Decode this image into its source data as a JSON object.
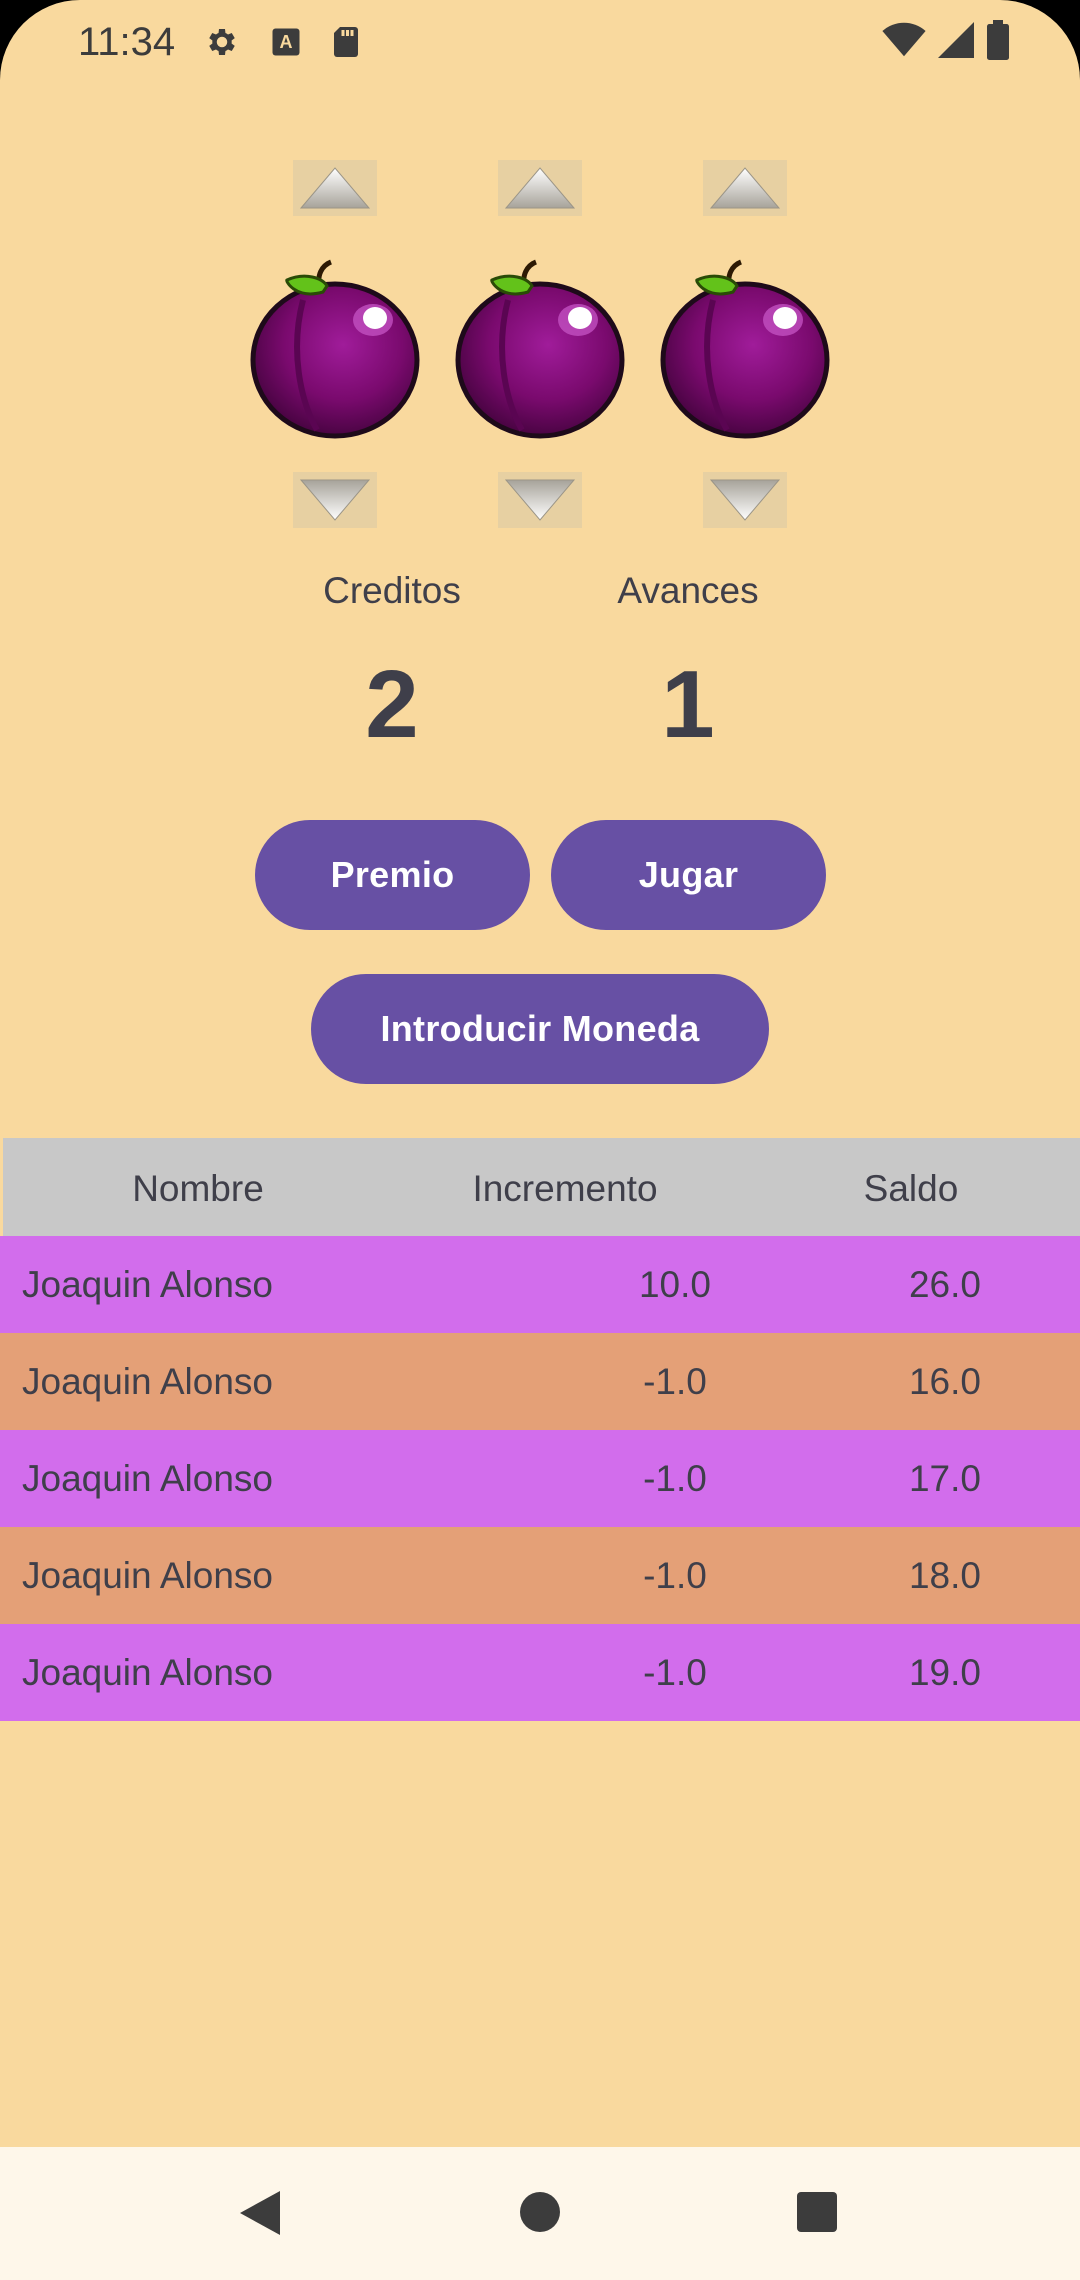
{
  "status_bar": {
    "time": "11:34",
    "icons_left": [
      "gear-icon",
      "keyboard-a-icon",
      "sd-card-icon"
    ],
    "icons_right": [
      "wifi-icon",
      "signal-icon",
      "battery-icon"
    ]
  },
  "reels": [
    {
      "symbol": "plum-icon",
      "up": "arrow-up-icon",
      "down": "arrow-down-icon"
    },
    {
      "symbol": "plum-icon",
      "up": "arrow-up-icon",
      "down": "arrow-down-icon"
    },
    {
      "symbol": "plum-icon",
      "up": "arrow-up-icon",
      "down": "arrow-down-icon"
    }
  ],
  "counters": {
    "creditos_label": "Creditos",
    "creditos_value": "2",
    "avances_label": "Avances",
    "avances_value": "1"
  },
  "buttons": {
    "premio": "Premio",
    "jugar": "Jugar",
    "introducir_moneda": "Introducir Moneda"
  },
  "table": {
    "headers": [
      "Nombre",
      "Incremento",
      "Saldo"
    ],
    "rows": [
      {
        "nombre": "Joaquin Alonso",
        "incremento": "10.0",
        "saldo": "26.0",
        "color": "#D26DEC"
      },
      {
        "nombre": "Joaquin Alonso",
        "incremento": "-1.0",
        "saldo": "16.0",
        "color": "#E4A077"
      },
      {
        "nombre": "Joaquin Alonso",
        "incremento": "-1.0",
        "saldo": "17.0",
        "color": "#D26DEC"
      },
      {
        "nombre": "Joaquin Alonso",
        "incremento": "-1.0",
        "saldo": "18.0",
        "color": "#E4A077"
      },
      {
        "nombre": "Joaquin Alonso",
        "incremento": "-1.0",
        "saldo": "19.0",
        "color": "#D26DEC"
      }
    ]
  },
  "colors": {
    "background": "#F9D99E",
    "accent": "#6750A4",
    "header_bg": "#C8C8C8",
    "row_purple": "#D26DEC",
    "row_orange": "#E4A077",
    "navbar_bg": "#FEF7EA"
  },
  "nav_bar": {
    "back": "back-triangle-icon",
    "home": "home-circle-icon",
    "recents": "recents-square-icon"
  }
}
